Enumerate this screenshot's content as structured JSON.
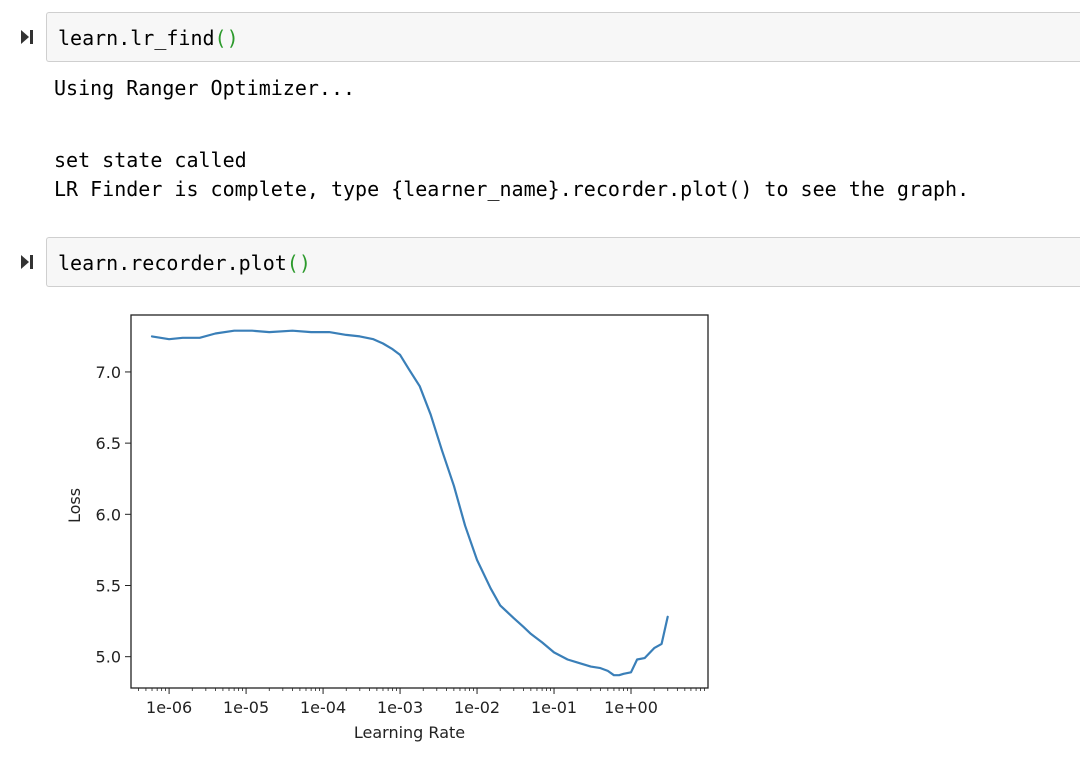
{
  "cells": [
    {
      "code_main": "learn.lr_find",
      "code_parens": "()",
      "output_lines": [
        "Using Ranger Optimizer...",
        "",
        "set state called",
        "LR Finder is complete, type {learner_name}.recorder.plot() to see the graph."
      ]
    },
    {
      "code_main": "learn.recorder.plot",
      "code_parens": "()"
    }
  ],
  "icons": {
    "run": "run-cell-icon"
  },
  "colors": {
    "code_bg": "#f7f7f7",
    "code_border": "#cfcfcf",
    "paren": "#2c9a2c",
    "line": "#3a7fb8"
  },
  "chart_data": {
    "type": "line",
    "title": "",
    "xlabel": "Learning Rate",
    "ylabel": "Loss",
    "xscale": "log",
    "xlim": [
      3.2e-07,
      10.0
    ],
    "ylim": [
      4.78,
      7.4
    ],
    "xticks": [
      1e-06,
      1e-05,
      0.0001,
      0.001,
      0.01,
      0.1,
      1
    ],
    "xtick_labels": [
      "1e-06",
      "1e-05",
      "1e-04",
      "1e-03",
      "1e-02",
      "1e-01",
      "1e+00"
    ],
    "yticks": [
      7.0,
      6.5,
      6.0,
      5.5,
      5.0
    ],
    "ytick_labels": [
      "7.0",
      "6.5",
      "6.0",
      "5.5",
      "5.0"
    ],
    "grid": false,
    "series": [
      {
        "x": [
          6e-07,
          1e-06,
          1.5e-06,
          2.5e-06,
          4e-06,
          7e-06,
          1.2e-05,
          2e-05,
          4e-05,
          7e-05,
          0.00012,
          0.0002,
          0.0003,
          0.00045,
          0.0006,
          0.0008,
          0.001,
          0.0013,
          0.0018,
          0.0025,
          0.0035,
          0.005,
          0.007,
          0.01,
          0.015,
          0.02,
          0.03,
          0.04,
          0.05,
          0.07,
          0.1,
          0.15,
          0.2,
          0.3,
          0.4,
          0.5,
          0.6,
          0.7,
          0.8,
          1.0,
          1.2,
          1.5,
          2.0,
          2.5,
          3.0
        ],
        "y": [
          7.25,
          7.23,
          7.24,
          7.24,
          7.27,
          7.29,
          7.29,
          7.28,
          7.29,
          7.28,
          7.28,
          7.26,
          7.25,
          7.23,
          7.2,
          7.16,
          7.12,
          7.02,
          6.9,
          6.7,
          6.45,
          6.2,
          5.92,
          5.68,
          5.48,
          5.36,
          5.27,
          5.21,
          5.16,
          5.1,
          5.03,
          4.98,
          4.96,
          4.93,
          4.92,
          4.9,
          4.87,
          4.87,
          4.88,
          4.89,
          4.98,
          4.99,
          5.06,
          5.09,
          5.28
        ]
      }
    ]
  }
}
